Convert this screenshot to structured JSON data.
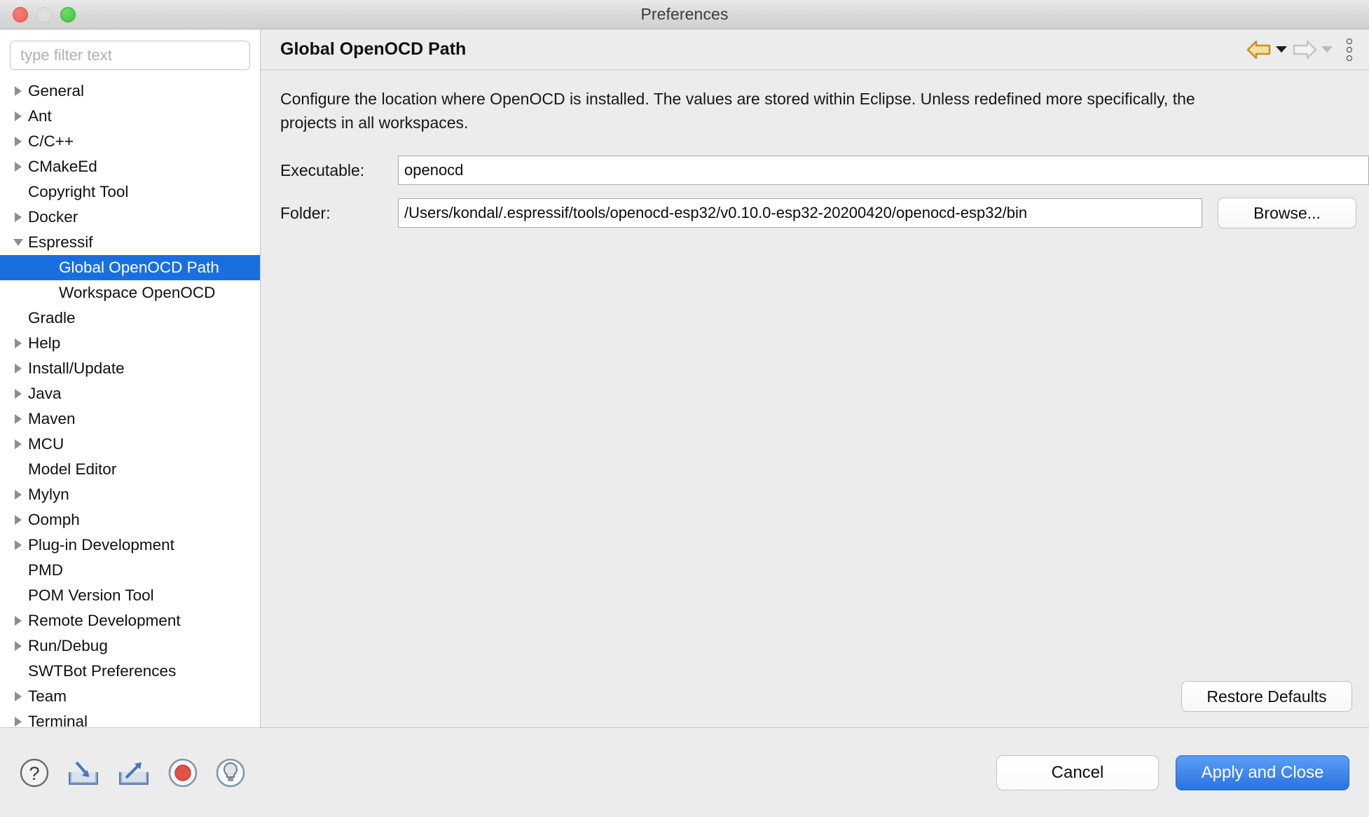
{
  "window": {
    "title": "Preferences",
    "traffic_lights": [
      "close",
      "minimize",
      "zoom"
    ]
  },
  "sidebar": {
    "filter": {
      "value": "",
      "placeholder": "type filter text"
    },
    "items": [
      {
        "label": "General",
        "depth": 1,
        "expander": "right",
        "selected": false
      },
      {
        "label": "Ant",
        "depth": 1,
        "expander": "right",
        "selected": false
      },
      {
        "label": "C/C++",
        "depth": 1,
        "expander": "right",
        "selected": false
      },
      {
        "label": "CMakeEd",
        "depth": 1,
        "expander": "right",
        "selected": false
      },
      {
        "label": "Copyright Tool",
        "depth": 1,
        "expander": "none",
        "selected": false
      },
      {
        "label": "Docker",
        "depth": 1,
        "expander": "right",
        "selected": false
      },
      {
        "label": "Espressif",
        "depth": 1,
        "expander": "down",
        "selected": false
      },
      {
        "label": "Global OpenOCD Path",
        "depth": 2,
        "expander": "none",
        "selected": true
      },
      {
        "label": "Workspace OpenOCD",
        "depth": 2,
        "expander": "none",
        "selected": false
      },
      {
        "label": "Gradle",
        "depth": 1,
        "expander": "none",
        "selected": false
      },
      {
        "label": "Help",
        "depth": 1,
        "expander": "right",
        "selected": false
      },
      {
        "label": "Install/Update",
        "depth": 1,
        "expander": "right",
        "selected": false
      },
      {
        "label": "Java",
        "depth": 1,
        "expander": "right",
        "selected": false
      },
      {
        "label": "Maven",
        "depth": 1,
        "expander": "right",
        "selected": false
      },
      {
        "label": "MCU",
        "depth": 1,
        "expander": "right",
        "selected": false
      },
      {
        "label": "Model Editor",
        "depth": 1,
        "expander": "none",
        "selected": false
      },
      {
        "label": "Mylyn",
        "depth": 1,
        "expander": "right",
        "selected": false
      },
      {
        "label": "Oomph",
        "depth": 1,
        "expander": "right",
        "selected": false
      },
      {
        "label": "Plug-in Development",
        "depth": 1,
        "expander": "right",
        "selected": false
      },
      {
        "label": "PMD",
        "depth": 1,
        "expander": "none",
        "selected": false
      },
      {
        "label": "POM Version Tool",
        "depth": 1,
        "expander": "none",
        "selected": false
      },
      {
        "label": "Remote Development",
        "depth": 1,
        "expander": "right",
        "selected": false
      },
      {
        "label": "Run/Debug",
        "depth": 1,
        "expander": "right",
        "selected": false
      },
      {
        "label": "SWTBot Preferences",
        "depth": 1,
        "expander": "none",
        "selected": false
      },
      {
        "label": "Team",
        "depth": 1,
        "expander": "right",
        "selected": false
      },
      {
        "label": "Terminal",
        "depth": 1,
        "expander": "right",
        "selected": false
      }
    ]
  },
  "content": {
    "page_title": "Global OpenOCD Path",
    "description": "Configure the location where OpenOCD is installed. The values are stored within Eclipse. Unless redefined more specifically, the\nprojects in all workspaces.",
    "nav": {
      "back_icon": "back-arrow-icon",
      "back_enabled": true,
      "forward_icon": "forward-arrow-icon",
      "forward_enabled": false,
      "menu_icon": "kebab-menu-icon"
    },
    "fields": {
      "executable": {
        "label": "Executable:",
        "value": "openocd",
        "placeholder": ""
      },
      "folder": {
        "label": "Folder:",
        "value": "/Users/kondal/.espressif/tools/openocd-esp32/v0.10.0-esp32-20200420/openocd-esp32/bin",
        "placeholder": "",
        "browse_label": "Browse..."
      }
    },
    "restore_defaults_label": "Restore Defaults"
  },
  "footer": {
    "icons": [
      "help-icon",
      "import-icon",
      "export-icon",
      "record-icon",
      "tip-lightbulb-icon"
    ],
    "cancel_label": "Cancel",
    "apply_label": "Apply and Close"
  },
  "colors": {
    "selection_blue": "#1a6fe0",
    "primary_button_blue": "#2a72e4",
    "back_arrow_gold": "#c8901e",
    "record_red": "#e0524a",
    "window_chrome": "#ececec"
  }
}
